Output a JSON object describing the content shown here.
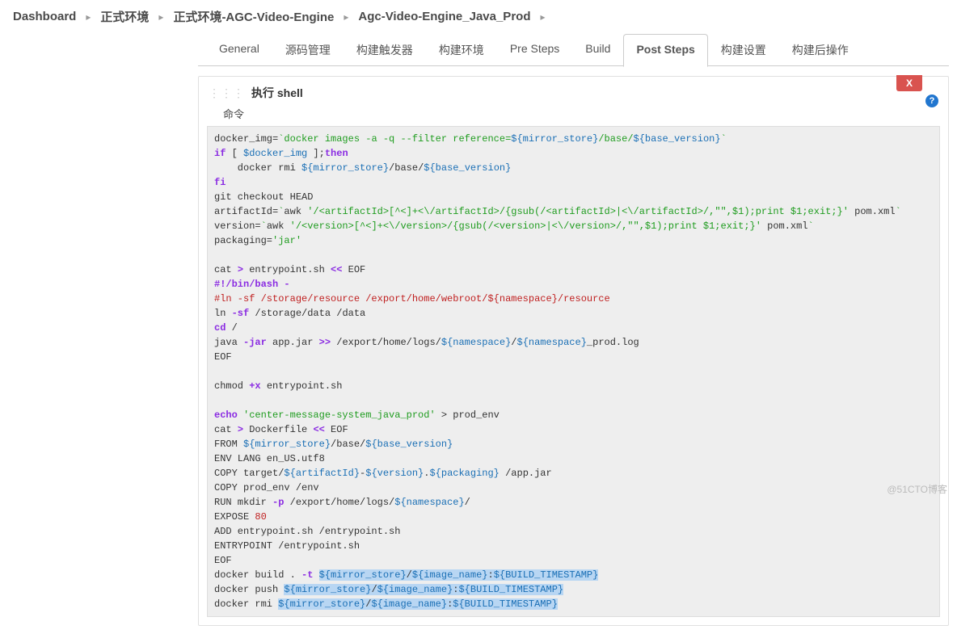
{
  "breadcrumb": {
    "items": [
      "Dashboard",
      "正式环境",
      "正式环境-AGC-Video-Engine",
      "Agc-Video-Engine_Java_Prod"
    ]
  },
  "tabs": {
    "items": [
      {
        "label": "General"
      },
      {
        "label": "源码管理"
      },
      {
        "label": "构建触发器"
      },
      {
        "label": "构建环境"
      },
      {
        "label": "Pre Steps"
      },
      {
        "label": "Build"
      },
      {
        "label": "Post Steps",
        "active": true
      },
      {
        "label": "构建设置"
      },
      {
        "label": "构建后操作"
      }
    ]
  },
  "step": {
    "title": "执行 shell",
    "close_label": "X",
    "help_label": "?",
    "field_label": "命令"
  },
  "shell": {
    "l01a": "docker_img=",
    "l01b": "`",
    "l01c": "docker images -a -q --filter reference=",
    "l01d": "${mirror_store}",
    "l01e": "/base/",
    "l01f": "${base_version}",
    "l01g": "`",
    "l02a": "if",
    "l02b": " [ ",
    "l02c": "$docker_img",
    "l02d": " ];",
    "l02e": "then",
    "l03a": "    docker rmi ",
    "l03b": "${mirror_store}",
    "l03c": "/base/",
    "l03d": "${base_version}",
    "l04": "fi",
    "l05": "git checkout HEAD",
    "l06a": "artifactId=",
    "l06b": "`",
    "l06c": "awk ",
    "l06d": "'/<artifactId>[^<]+<\\/artifactId>/{gsub(/<artifactId>|<\\/artifactId>/,\"\",$1);print $1;exit;}'",
    "l06e": " pom.xml",
    "l06f": "`",
    "l07a": "version=",
    "l07b": "`",
    "l07c": "awk ",
    "l07d": "'/<version>[^<]+<\\/version>/{gsub(/<version>|<\\/version>/,\"\",$1);print $1;exit;}'",
    "l07e": " pom.xml",
    "l07f": "`",
    "l08a": "packaging=",
    "l08b": "'jar'",
    "blank1": "",
    "l09a": "cat ",
    "l09b": ">",
    "l09c": " entrypoint.sh ",
    "l09d": "<<",
    "l09e": " EOF",
    "l10a": "#!/bin/bash -",
    "l11a": "#ln -sf /storage/resource /export/home/webroot/",
    "l11b": "${namespace}",
    "l11c": "/resource",
    "l12a": "ln ",
    "l12b": "-sf",
    "l12c": " /storage/data /data",
    "l13a": "cd",
    "l13b": " /",
    "l14a": "java ",
    "l14b": "-jar",
    "l14c": " app.jar ",
    "l14d": ">>",
    "l14e": " /export/home/logs/",
    "l14f": "${namespace}",
    "l14g": "/",
    "l14h": "${namespace}",
    "l14i": "_prod.log",
    "l15": "EOF",
    "blank2": "",
    "l16a": "chmod ",
    "l16b": "+x",
    "l16c": " entrypoint.sh",
    "blank3": "",
    "l17a": "echo ",
    "l17b": "'center-message-system_java_prod'",
    "l17c": " > prod_env",
    "l18a": "cat ",
    "l18b": ">",
    "l18c": " Dockerfile ",
    "l18d": "<<",
    "l18e": " EOF",
    "l19a": "FROM ",
    "l19b": "${mirror_store}",
    "l19c": "/base/",
    "l19d": "${base_version}",
    "l20": "ENV LANG en_US.utf8",
    "l21a": "COPY target/",
    "l21b": "${artifactId}",
    "l21c": "-",
    "l21d": "${version}",
    "l21e": ".",
    "l21f": "${packaging}",
    "l21g": " /app.jar",
    "l22": "COPY prod_env /env",
    "l23a": "RUN mkdir ",
    "l23b": "-p",
    "l23c": " /export/home/logs/",
    "l23d": "${namespace}",
    "l23e": "/",
    "l24a": "EXPOSE ",
    "l24b": "80",
    "l25": "ADD entrypoint.sh /entrypoint.sh",
    "l26": "ENTRYPOINT /entrypoint.sh",
    "l27": "EOF",
    "l28a": "docker build . ",
    "l28b": "-t",
    "l28c": " ",
    "l28d": "${mirror_store}",
    "l28e": "/",
    "l28f": "${image_name}",
    "l28g": ":",
    "l28h": "${BUILD_TIMESTAMP}",
    "l29a": "docker push ",
    "l29b": "${mirror_store}",
    "l29c": "/",
    "l29d": "${image_name}",
    "l29e": ":",
    "l29f": "${BUILD_TIMESTAMP}",
    "l30a": "docker rmi ",
    "l30b": "${mirror_store}",
    "l30c": "/",
    "l30d": "${image_name}",
    "l30e": ":",
    "l30f": "${BUILD_TIMESTAMP}"
  },
  "watermark": "@51CTO博客"
}
